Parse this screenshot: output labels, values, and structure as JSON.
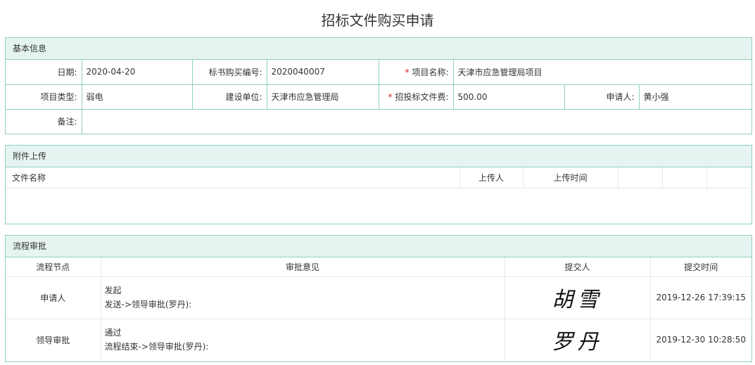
{
  "page": {
    "title": "招标文件购买申请"
  },
  "basic": {
    "header": "基本信息",
    "date_label": "日期:",
    "date_value": "2020-04-20",
    "bid_no_label": "标书购买编号:",
    "bid_no_value": "2020040007",
    "project_name_label": "项目名称:",
    "project_name_value": "天津市应急管理局项目",
    "project_type_label": "项目类型:",
    "project_type_value": "弱电",
    "builder_label": "建设单位:",
    "builder_value": "天津市应急管理局",
    "fee_label": "招投标文件费:",
    "fee_value": "500.00",
    "applicant_label": "申请人:",
    "applicant_value": "黄小强",
    "remark_label": "备注:",
    "remark_value": "",
    "required_mark": "*"
  },
  "attachments": {
    "header": "附件上传",
    "columns": [
      "文件名称",
      "上传人",
      "上传时间",
      "",
      "",
      ""
    ],
    "rows": []
  },
  "flow": {
    "header": "流程审批",
    "columns": [
      "流程节点",
      "审批意见",
      "提交人",
      "提交时间"
    ],
    "rows": [
      {
        "node": "申请人",
        "opinion_1": "发起",
        "opinion_2": "发送->领导审批(罗丹):",
        "submitter": "胡雪",
        "time": "2019-12-26 17:39:15"
      },
      {
        "node": "领导审批",
        "opinion_1": "通过",
        "opinion_2": "流程结束->领导审批(罗丹):",
        "submitter": "罗丹",
        "time": "2019-12-30 10:28:50"
      }
    ]
  }
}
